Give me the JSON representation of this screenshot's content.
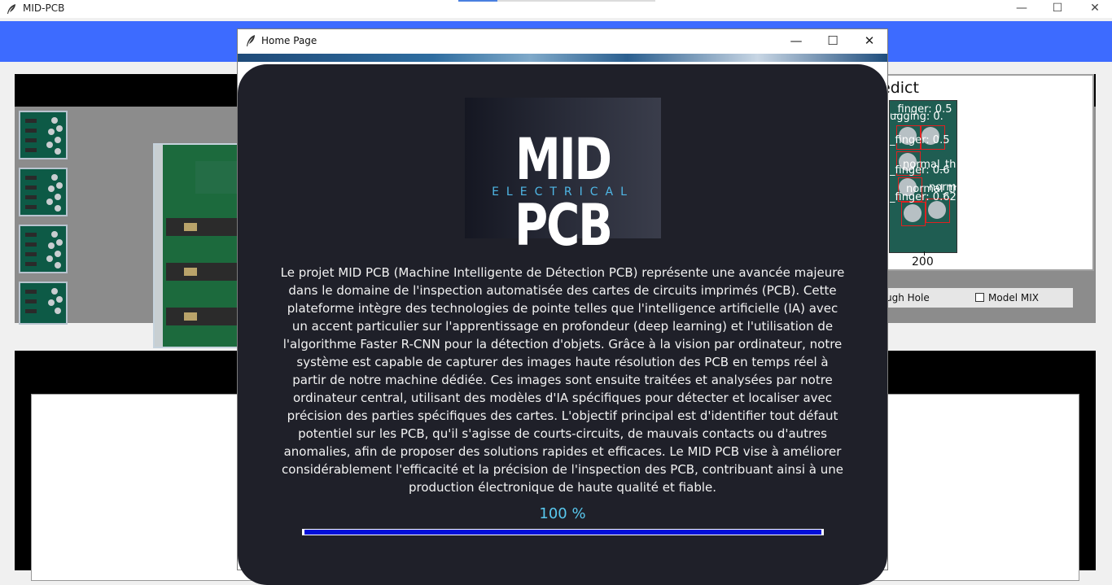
{
  "main_window": {
    "title": "MID-PCB",
    "minimize_glyph": "—",
    "maximize_glyph": "☐",
    "close_glyph": "✕",
    "icon": "feather-icon"
  },
  "predict_panel": {
    "title": "edict",
    "x_tick_label": "200",
    "labels": [
      "_finger: 0.5",
      "ugging: 0.",
      "_finger: 0.5",
      "normal_th",
      "_finger: 0.6",
      "normal_th",
      "norm",
      "_finger: 0.62"
    ]
  },
  "options": {
    "through_hole_label": "ugh Hole",
    "model_mix_label": "Model MIX"
  },
  "dialog": {
    "title": "Home Page",
    "minimize_glyph": "—",
    "maximize_glyph": "☐",
    "close_glyph": "✕",
    "logo_main": "MID PCB",
    "logo_sub": "ELECTRICAL",
    "description": "Le projet MID PCB (Machine Intelligente de Détection PCB) représente une avancée majeure dans le domaine de l'inspection automatisée des cartes de circuits imprimés (PCB). Cette plateforme intègre des technologies de pointe telles que l'intelligence artificielle (IA) avec un accent particulier sur l'apprentissage en profondeur (deep learning) et l'utilisation de l'algorithme Faster R-CNN pour la détection d'objets. Grâce à la vision par ordinateur, notre système est capable de capturer des images haute résolution des PCB en temps réel à partir de notre machine dédiée. Ces images sont ensuite traitées et analysées par notre ordinateur central, utilisant des modèles d'IA spécifiques pour détecter et localiser avec précision des parties spécifiques des cartes. L'objectif principal est d'identifier tout défaut potentiel sur les PCB, qu'il s'agisse de courts-circuits, de mauvais contacts ou d'autres anomalies, afin de proposer des solutions rapides et efficaces. Le MID PCB vise à améliorer considérablement l'efficacité et la précision de l'inspection des PCB, contribuant ainsi à une production électronique de haute qualité et fiable.",
    "progress_text": "100 %",
    "progress_value": 100
  },
  "colors": {
    "accent_blue": "#3d6bff",
    "card_bg": "#1f2029",
    "percent_text": "#59c8ee",
    "progress_fill": "#0010d8"
  }
}
